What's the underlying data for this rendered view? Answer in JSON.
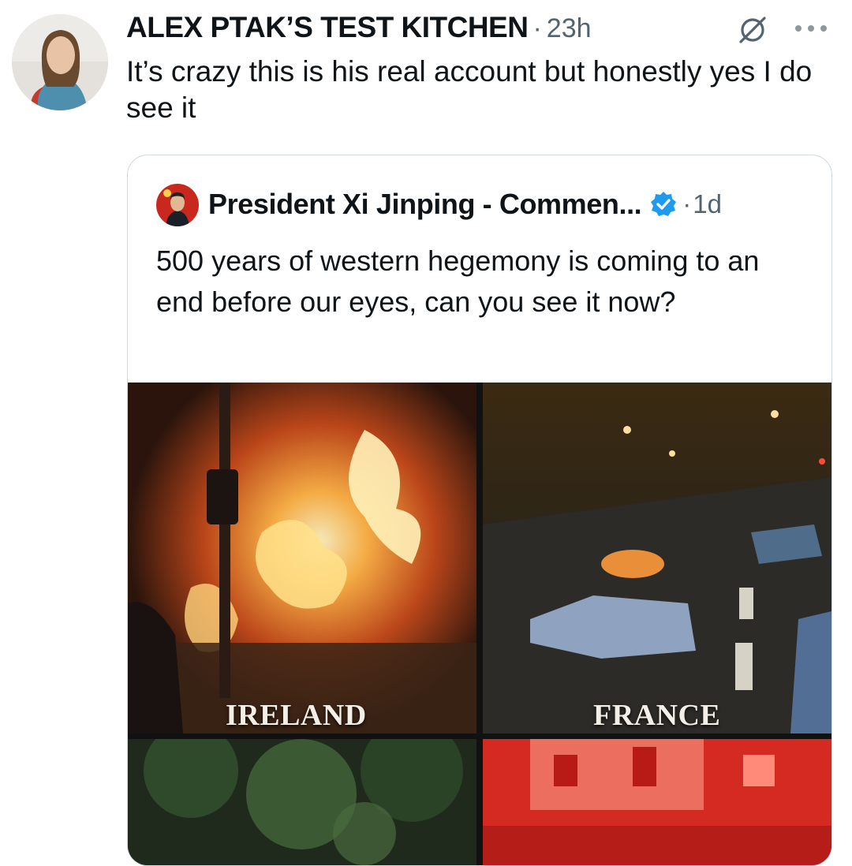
{
  "post": {
    "author_name": "ALEX PTAK’S TEST KITCHEN",
    "separator": "·",
    "time": "23h",
    "text": "It’s crazy this is his real account but honestly yes I do see it",
    "icons": {
      "grok": "grok-slash-icon",
      "more": "more-horizontal-icon"
    }
  },
  "quote": {
    "author_name": "President Xi Jinping - Commen...",
    "separator": "·",
    "time": "1d",
    "verified_icon": "verified-badge-icon",
    "verified_color": "#1d9bf0",
    "text": "500 years of western hegemony is coming to an end before our eyes, can you see it now?",
    "media": [
      {
        "caption": "IRELAND"
      },
      {
        "caption": "FRANCE"
      },
      {
        "caption": ""
      },
      {
        "caption": ""
      }
    ]
  },
  "colors": {
    "text_primary": "#0f1419",
    "text_secondary": "#536471",
    "border": "#cfd9de"
  }
}
